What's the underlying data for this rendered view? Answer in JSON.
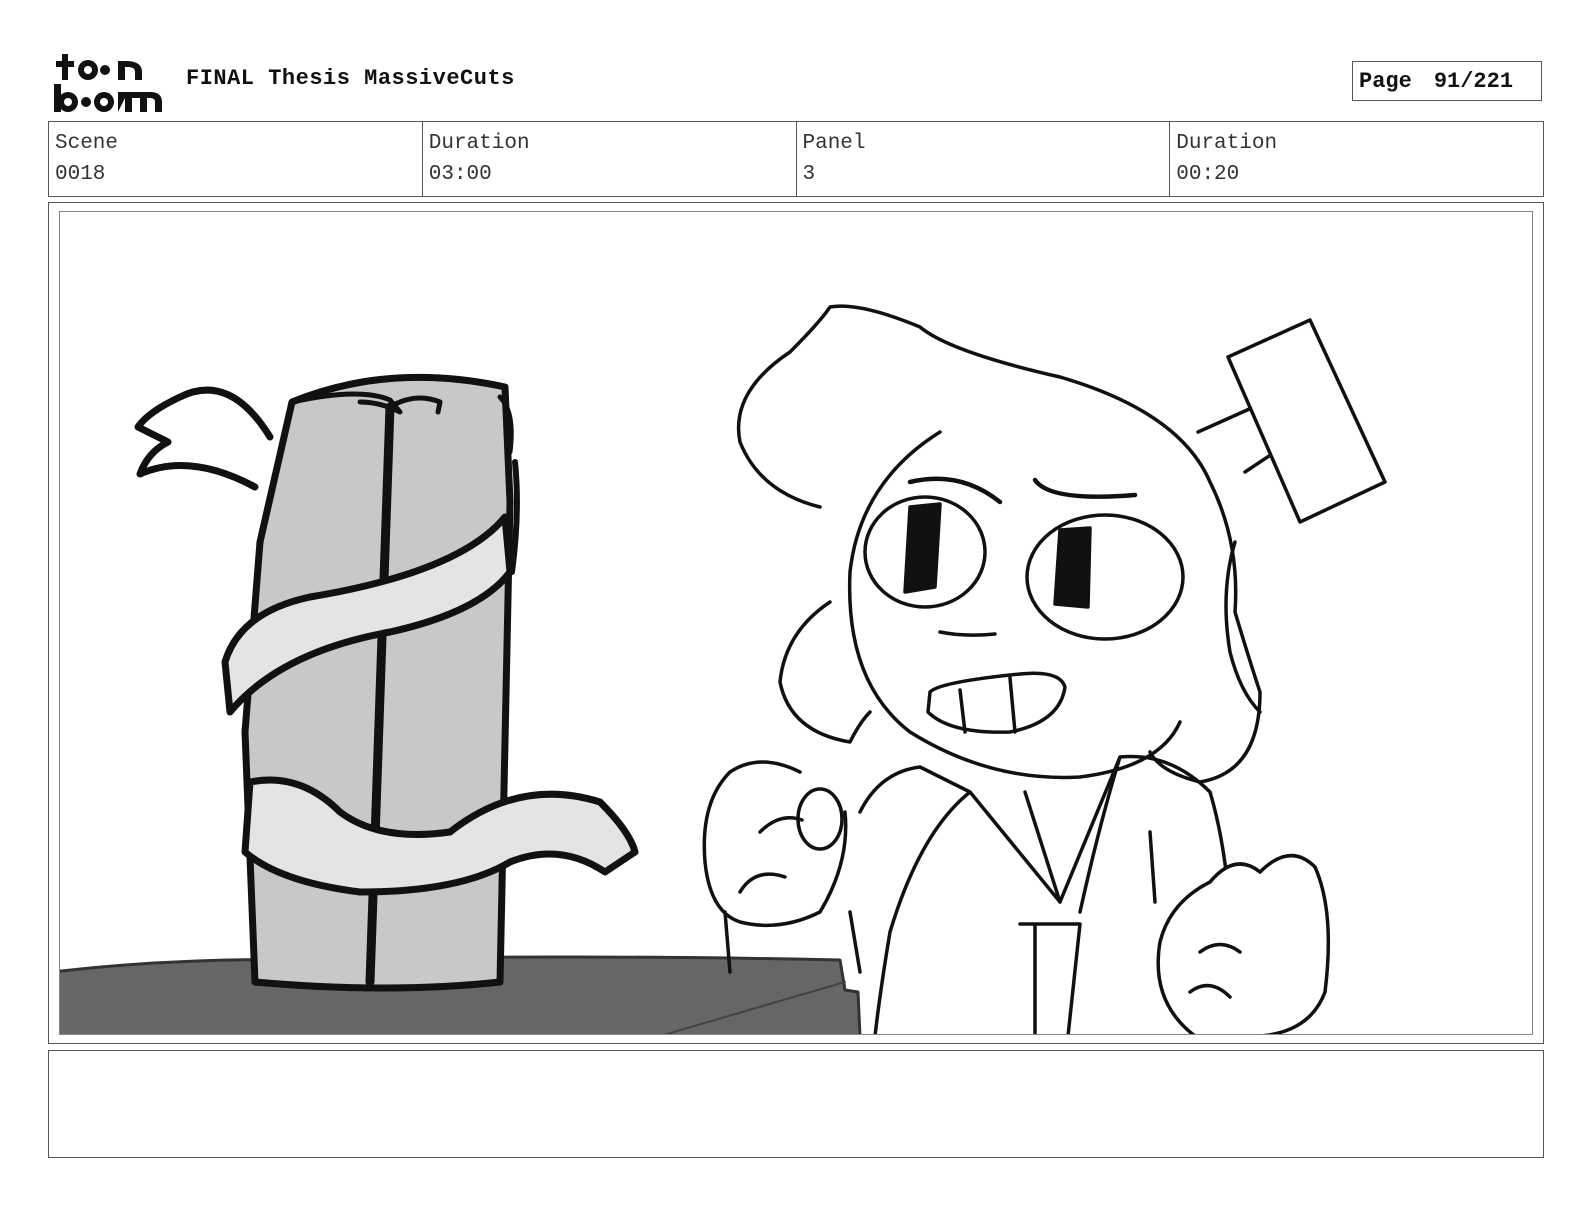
{
  "header": {
    "logo_top": "t•on",
    "logo_bottom": "b•om",
    "project_title": "FINAL Thesis MassiveCuts",
    "page_label": "Page",
    "page_value": "91/221"
  },
  "info": {
    "scene_label": "Scene",
    "scene_value": "0018",
    "scene_duration_label": "Duration",
    "scene_duration_value": "03:00",
    "panel_label": "Panel",
    "panel_value": "3",
    "panel_duration_label": "Duration",
    "panel_duration_value": "00:20"
  },
  "notes": {
    "text": ""
  },
  "colors": {
    "border": "#555555",
    "scroll_gray": "#c8c8c8",
    "ribbon_gray": "#e4e4e4",
    "table_gray": "#666666"
  }
}
